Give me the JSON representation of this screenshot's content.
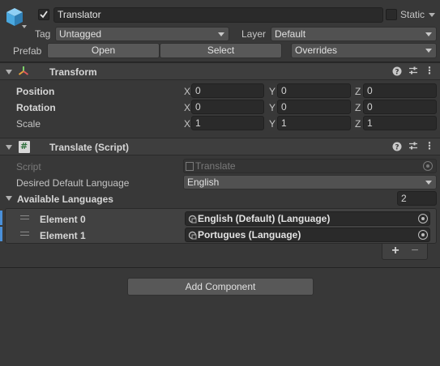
{
  "gameobject": {
    "enabled": true,
    "name": "Translator",
    "static_label": "Static",
    "static_checked": false,
    "tag_label": "Tag",
    "tag_value": "Untagged",
    "layer_label": "Layer",
    "layer_value": "Default",
    "prefab_label": "Prefab",
    "prefab_open": "Open",
    "prefab_select": "Select",
    "prefab_overrides": "Overrides"
  },
  "transform": {
    "title": "Transform",
    "rows": [
      {
        "label": "Position",
        "x": "0",
        "y": "0",
        "z": "0"
      },
      {
        "label": "Rotation",
        "x": "0",
        "y": "0",
        "z": "0"
      },
      {
        "label": "Scale",
        "x": "1",
        "y": "1",
        "z": "1"
      }
    ],
    "axes": {
      "x": "X",
      "y": "Y",
      "z": "Z"
    }
  },
  "script_component": {
    "title": "Translate (Script)",
    "script_label": "Script",
    "script_value": "Translate",
    "default_lang_label": "Desired Default Language",
    "default_lang_value": "English",
    "available_label": "Available Languages",
    "available_count": "2",
    "elements": [
      {
        "label": "Element 0",
        "value": "English (Default) (Language)"
      },
      {
        "label": "Element 1",
        "value": "Portugues (Language)"
      }
    ],
    "add_symbol": "+",
    "remove_symbol": "−"
  },
  "add_component_label": "Add Component",
  "colors": {
    "background": "#383838",
    "field": "#2a2a2a",
    "header": "#3e3e3e",
    "accent_blue": "#4a90d9"
  }
}
